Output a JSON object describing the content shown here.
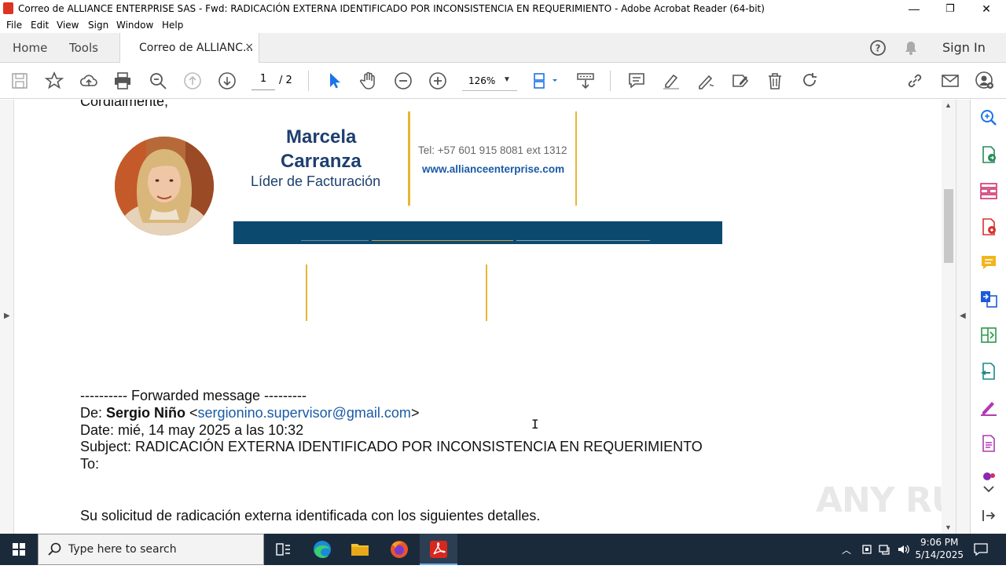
{
  "window": {
    "title": "Correo de ALLIANCE ENTERPRISE SAS - Fwd: RADICACIÓN EXTERNA IDENTIFICADO POR INCONSISTENCIA EN REQUERIMIENTO - Adobe Acrobat Reader (64-bit)",
    "minimize": "—",
    "maximize": "❐",
    "close": "✕"
  },
  "menu": [
    "File",
    "Edit",
    "View",
    "Sign",
    "Window",
    "Help"
  ],
  "tabs": {
    "home": "Home",
    "tools": "Tools",
    "document": "Correo de ALLIANC...",
    "close": "×",
    "sign_in": "Sign In"
  },
  "toolbar": {
    "page_current": "1",
    "page_total": "/ 2",
    "zoom": "126%"
  },
  "signature": {
    "salutation": "Cordialmente,",
    "name_line1": "Marcela",
    "name_line2": "Carranza",
    "role": "Líder de Facturación",
    "phone": "Tel: +57 601 915 8081 ext 1312",
    "website": "www.allianceenterprise.com"
  },
  "forwarded": {
    "header": "---------- Forwarded message ---------",
    "from_label": "De: ",
    "from_name": "Sergio Niño",
    "from_open": " <",
    "from_email": "sergionino.supervisor@gmail.com",
    "from_close": ">",
    "date": "Date: mié, 14 may 2025 a las 10:32",
    "subject": "Subject: RADICACIÓN EXTERNA IDENTIFICADO POR INCONSISTENCIA EN REQUERIMIENTO",
    "to": "To:",
    "body": "Su solicitud de radicación externa identificada con los siguientes detalles."
  },
  "watermark": "ANY RUN",
  "taskbar": {
    "search_placeholder": "Type here to search",
    "time": "9:06 PM",
    "date": "5/14/2025"
  },
  "colors": {
    "accent_yellow": "#e8b634",
    "banner_navy": "#0b4a6e",
    "name_navy": "#1d3f6e",
    "link_blue": "#1a5aa6",
    "taskbar": "#1b2a3b"
  }
}
